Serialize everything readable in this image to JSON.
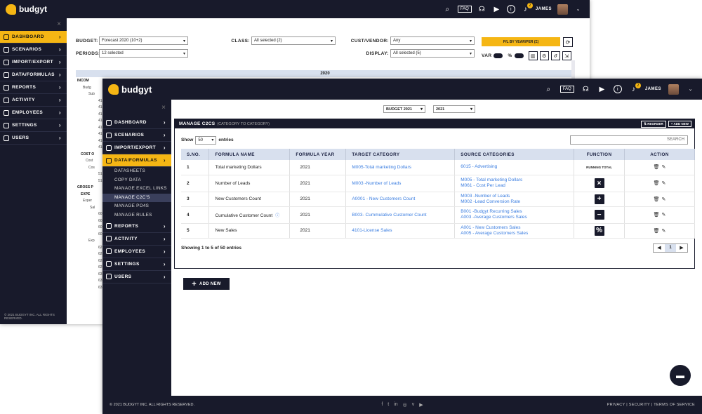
{
  "app": {
    "name": "budgyt",
    "user": "JAMES",
    "faq": "FAQ",
    "notif_count": "2"
  },
  "back": {
    "nav": [
      {
        "label": "DASHBOARD",
        "icon": "home-icon",
        "active": true
      },
      {
        "label": "SCENARIOS",
        "icon": "scenario-icon"
      },
      {
        "label": "IMPORT/EXPORT",
        "icon": "import-icon"
      },
      {
        "label": "DATA/FORMULAS",
        "icon": "data-icon"
      },
      {
        "label": "REPORTS",
        "icon": "report-icon"
      },
      {
        "label": "ACTIVITY",
        "icon": "activity-icon"
      },
      {
        "label": "EMPLOYEES",
        "icon": "employees-icon"
      },
      {
        "label": "SETTINGS",
        "icon": "settings-icon"
      },
      {
        "label": "USERS",
        "icon": "users-icon"
      }
    ],
    "budget_label": "BUDGET:",
    "budget_value": "Forecast 2020 (10+2)",
    "periods_label": "PERIODS:",
    "periods_value": "12 selected",
    "class_label": "CLASS:",
    "class_value": "All selected (2)",
    "cust_label": "CUST/VENDOR:",
    "cust_value": "Any",
    "display_label": "DISPLAY:",
    "display_value": "All selected (5)",
    "pl_button": "P/L BY YEAR/PER (Σ)",
    "var_label": "VAR",
    "pct_label": "%",
    "year_header": "2020",
    "tree": [
      "INCOM",
      "Budg",
      "Sub",
      "41",
      "41",
      "41",
      "41",
      "41",
      "41",
      "41",
      "41",
      "COST O",
      "Cost",
      "Cos",
      "51",
      "51",
      "GROSS P",
      "EXPE",
      "Exper",
      "Sal",
      "60",
      "60",
      "60",
      "60",
      "Exp",
      "62",
      "62",
      "62",
      "62",
      "63",
      "63",
      "63"
    ],
    "copyright": "© 2021 BUDGYT INC. ALL RIGHTS RESERVED."
  },
  "front": {
    "nav_top": [
      {
        "label": "DASHBOARD",
        "icon": "home-icon"
      },
      {
        "label": "SCENARIOS",
        "icon": "scenario-icon"
      },
      {
        "label": "IMPORT/EXPORT",
        "icon": "import-icon"
      },
      {
        "label": "DATA/FORMULAS",
        "icon": "data-icon",
        "active": true
      }
    ],
    "subnav": [
      "DATASHEETS",
      "COPY DATA",
      "MANAGE EXCEL LINKS",
      "MANAGE C2C'S",
      "MANAGE PO4S",
      "MANAGE RULES"
    ],
    "subnav_active": 3,
    "nav_bottom": [
      {
        "label": "REPORTS",
        "icon": "report-icon"
      },
      {
        "label": "ACTIVITY",
        "icon": "activity-icon"
      },
      {
        "label": "EMPLOYEES",
        "icon": "employees-icon"
      },
      {
        "label": "SETTINGS",
        "icon": "settings-icon"
      },
      {
        "label": "USERS",
        "icon": "users-icon"
      }
    ],
    "budget_select": "BUDGET 2021",
    "year_select": "2021",
    "panel_title": "MANAGE C2CS",
    "panel_subtitle": "(CATEGORY TO CATEGORY)",
    "reorder": "REORDER",
    "add_new_small": "ADD NEW",
    "show_label": "Show",
    "show_value": "50",
    "entries_label": "entries",
    "search_placeholder": "SEARCH",
    "columns": [
      "S.NO.",
      "FORMULA NAME",
      "FORMULA YEAR",
      "TARGET CATEGORY",
      "SOURCE CATEGORIES",
      "FUNCTION",
      "ACTION"
    ],
    "rows": [
      {
        "no": "1",
        "name": "Total marketing Dollars",
        "year": "2021",
        "target": "M005-Total marketing Dollars",
        "sources": [
          "6015 - Advertising"
        ],
        "func": "RUNNING TOTAL",
        "func_type": "text"
      },
      {
        "no": "2",
        "name": "Number of Leads",
        "year": "2021",
        "target": "M003 -Number of Leads",
        "sources": [
          "M005 - Total marketing Dollars",
          "M061 - Cost Per Lead"
        ],
        "func": "×",
        "func_type": "btn"
      },
      {
        "no": "3",
        "name": "New Customers Count",
        "year": "2021",
        "target": "A0001 - New Customers Count",
        "sources": [
          "M003 -Number of Leads",
          "M002 -Lead Conversion Rate"
        ],
        "func": "+",
        "func_type": "btn"
      },
      {
        "no": "4",
        "name": "Cumulative Customer Count",
        "year": "2021",
        "target": "B003- Cummulative Customer Count",
        "sources": [
          "B001 -Budgyt Recurring Sales",
          "A003 -Average Customers Sales"
        ],
        "func": "−",
        "func_type": "btn"
      },
      {
        "no": "5",
        "name": "New Sales",
        "year": "2021",
        "target": "4101-License Sales",
        "sources": [
          "A001 - New Customers Sales",
          "A005 - Average Customers Sales"
        ],
        "func": "%",
        "func_type": "btn"
      }
    ],
    "showing": "Showing 1 to 5 of 50 entries",
    "page": "1",
    "add_new": "ADD NEW",
    "copyright": "© 2021 BUDGYT INC. ALL RIGHTS RESERVED.",
    "footer_links": "PRIVACY | SECURITY | TERMS OF SERVICE"
  },
  "colors": {
    "accent": "#f5b614",
    "dark": "#181a2b",
    "link": "#3a7de0"
  }
}
